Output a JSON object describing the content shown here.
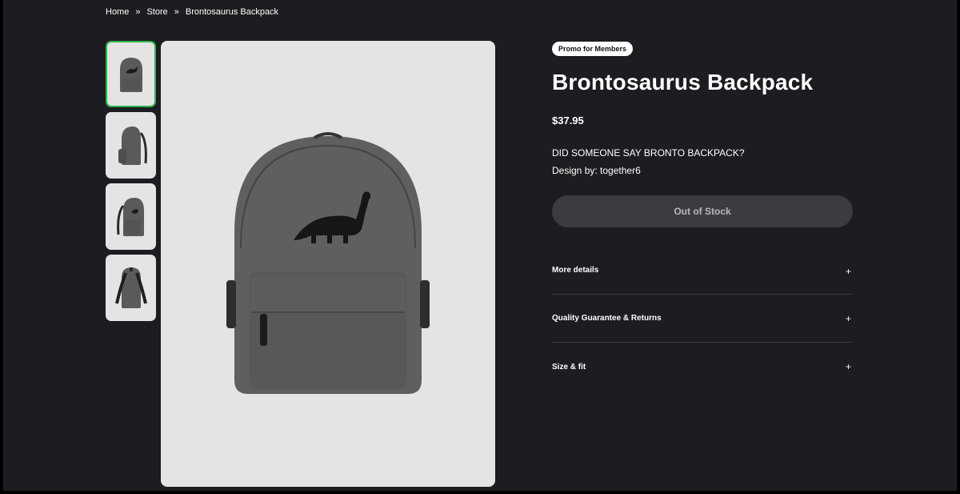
{
  "breadcrumb": {
    "items": [
      "Home",
      "Store",
      "Brontosaurus Backpack"
    ],
    "separator": "»"
  },
  "gallery": {
    "thumbnails": [
      "front-view",
      "side-view",
      "angle-view",
      "back-view"
    ],
    "active_index": 0,
    "accent_color": "#2fb24c"
  },
  "product": {
    "badge": "Promo for Members",
    "title": "Brontosaurus Backpack",
    "price": "$37.95",
    "description": "DID SOMEONE SAY BRONTO BACKPACK?",
    "designer": "Design by: together6",
    "stock_button": "Out of Stock"
  },
  "accordion": [
    {
      "label": "More details",
      "icon": "+"
    },
    {
      "label": "Quality Guarantee & Returns",
      "icon": "+"
    },
    {
      "label": "Size & fit",
      "icon": "+"
    }
  ]
}
